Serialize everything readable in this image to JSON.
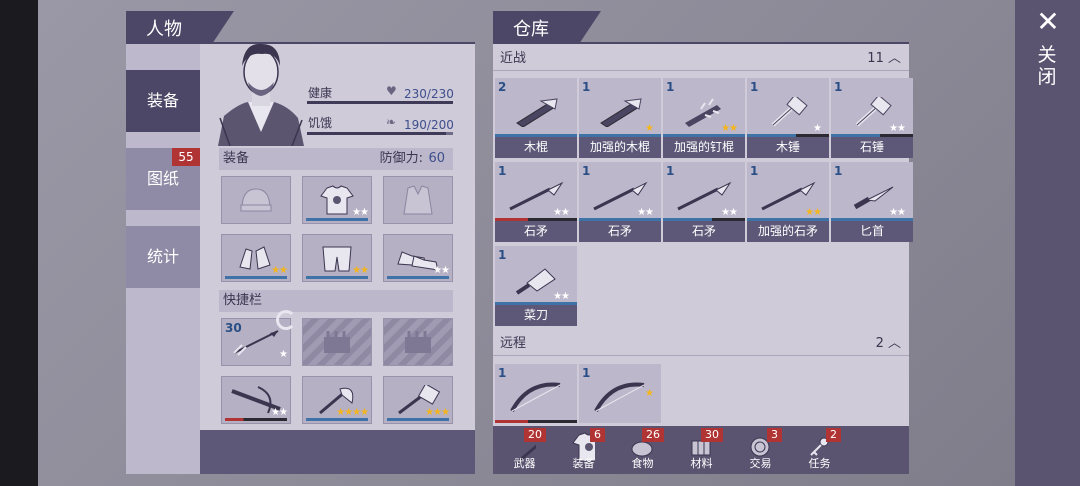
{
  "close": {
    "icon": "close-icon",
    "label": "关闭"
  },
  "character": {
    "title": "人物",
    "tabs": [
      {
        "label": "装备",
        "badge": ""
      },
      {
        "label": "图纸",
        "badge": "55"
      },
      {
        "label": "统计",
        "badge": ""
      }
    ],
    "health": {
      "label": "健康",
      "value": "230/230",
      "fraction": 1.0
    },
    "hunger": {
      "label": "饥饿",
      "value": "190/200",
      "fraction": 0.95
    },
    "equip": {
      "label": "装备",
      "defense_label": "防御力:",
      "defense_value": "60"
    },
    "equip_slots": [
      {
        "icon": "beanie-icon",
        "stars": 0,
        "star_color": "",
        "bar": "none"
      },
      {
        "icon": "shirt-icon",
        "stars": 2,
        "star_color": "white",
        "bar": "blue"
      },
      {
        "icon": "jacket-icon",
        "stars": 0,
        "star_color": "",
        "bar": "none"
      },
      {
        "icon": "gloves-icon",
        "stars": 2,
        "star_color": "gold",
        "bar": "blue"
      },
      {
        "icon": "pants-icon",
        "stars": 2,
        "star_color": "gold",
        "bar": "blue"
      },
      {
        "icon": "shoes-icon",
        "stars": 2,
        "star_color": "white",
        "bar": "blue"
      }
    ],
    "quickbar": {
      "label": "快捷栏"
    },
    "quick_slots": [
      {
        "icon": "arrow-icon",
        "qty": "30",
        "stars": 1,
        "star_color": "white",
        "bar": "none"
      },
      {
        "icon": "locked-slot-icon",
        "qty": "",
        "stars": 0,
        "star_color": "",
        "bar": "none",
        "locked": true
      },
      {
        "icon": "locked-slot-icon",
        "qty": "",
        "stars": 0,
        "star_color": "",
        "bar": "none",
        "locked": true
      },
      {
        "icon": "crossbow-icon",
        "qty": "",
        "stars": 2,
        "star_color": "white",
        "bar": "red"
      },
      {
        "icon": "axe-icon",
        "qty": "",
        "stars": 4,
        "star_color": "gold",
        "bar": "blue"
      },
      {
        "icon": "mace-icon",
        "qty": "",
        "stars": 3,
        "star_color": "gold",
        "bar": "blue"
      }
    ]
  },
  "storage": {
    "title": "仓库",
    "melee": {
      "label": "近战",
      "count": "11"
    },
    "melee_items": [
      {
        "name": "木棍",
        "qty": "2",
        "stars": 0,
        "star_color": "",
        "bar": "blue",
        "icon": "club-icon"
      },
      {
        "name": "加强的木棍",
        "qty": "1",
        "stars": 1,
        "star_color": "gold",
        "bar": "blue",
        "icon": "club-icon"
      },
      {
        "name": "加强的钉棍",
        "qty": "1",
        "stars": 2,
        "star_color": "gold",
        "bar": "blue",
        "icon": "spiked-club-icon"
      },
      {
        "name": "木锤",
        "qty": "1",
        "stars": 1,
        "star_color": "white",
        "bar": "dark",
        "icon": "hammer-icon"
      },
      {
        "name": "石锤",
        "qty": "1",
        "stars": 2,
        "star_color": "white",
        "bar": "dark",
        "icon": "hammer-icon"
      },
      {
        "name": "石矛",
        "qty": "1",
        "stars": 2,
        "star_color": "white",
        "bar": "red",
        "icon": "spear-icon"
      },
      {
        "name": "石矛",
        "qty": "1",
        "stars": 2,
        "star_color": "white",
        "bar": "blue",
        "icon": "spear-icon"
      },
      {
        "name": "石矛",
        "qty": "1",
        "stars": 2,
        "star_color": "white",
        "bar": "dark",
        "icon": "spear-icon"
      },
      {
        "name": "加强的石矛",
        "qty": "1",
        "stars": 2,
        "star_color": "gold",
        "bar": "blue",
        "icon": "spear-icon"
      },
      {
        "name": "匕首",
        "qty": "1",
        "stars": 2,
        "star_color": "white",
        "bar": "blue",
        "icon": "dagger-icon"
      },
      {
        "name": "菜刀",
        "qty": "1",
        "stars": 2,
        "star_color": "white",
        "bar": "blue",
        "icon": "cleaver-icon"
      }
    ],
    "ranged": {
      "label": "远程",
      "count": "2"
    },
    "ranged_items": [
      {
        "name": "",
        "qty": "1",
        "stars": 0,
        "star_color": "",
        "bar": "red",
        "icon": "bow-icon"
      },
      {
        "name": "",
        "qty": "1",
        "stars": 1,
        "star_color": "gold",
        "bar": "none",
        "icon": "bow-icon"
      }
    ],
    "categories": [
      {
        "label": "武器",
        "badge": "20",
        "icon": "axe-icon"
      },
      {
        "label": "装备",
        "badge": "6",
        "icon": "shirt-icon"
      },
      {
        "label": "食物",
        "badge": "26",
        "icon": "food-icon"
      },
      {
        "label": "材料",
        "badge": "30",
        "icon": "wood-icon"
      },
      {
        "label": "交易",
        "badge": "3",
        "icon": "coin-icon"
      },
      {
        "label": "任务",
        "badge": "2",
        "icon": "key-icon"
      }
    ]
  }
}
